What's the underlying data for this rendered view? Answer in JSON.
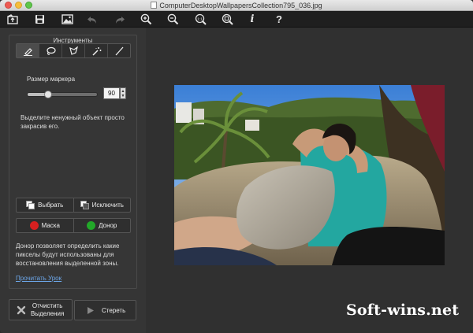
{
  "window": {
    "title": "ComputerDesktopWallpapersCollection795_036.jpg"
  },
  "toolbar": {
    "buttons": [
      "open-icon",
      "save-icon",
      "image-icon",
      "undo-icon",
      "redo-icon",
      "zoom-in-icon",
      "zoom-out-icon",
      "actual-size-icon",
      "fit-icon",
      "info-icon",
      "help-icon"
    ],
    "actual_size_label": "1:1",
    "info_label": "i",
    "help_label": "?"
  },
  "panel": {
    "title": "Инструменты",
    "marker_size_label": "Размер маркера",
    "marker_size_value": "90",
    "marker_size_fraction": 0.3,
    "hint": "Выделите ненужный объект просто закрасив его.",
    "select_label": "Выбрать",
    "exclude_label": "Исключить",
    "mask_label": "Маска",
    "donor_label": "Донор",
    "description": "Донор позволяет определить какие пикселы будут использованы для восстановления выделенной зоны.",
    "lesson_link": "Прочитать Урок"
  },
  "bottom": {
    "clear_label_line1": "Отчистить",
    "clear_label_line2": "Выделения",
    "erase_label": "Стереть"
  },
  "colors": {
    "mask": "#d62020",
    "donor": "#22a829",
    "link": "#6ca6e8"
  },
  "watermark": "Soft-wins.net"
}
